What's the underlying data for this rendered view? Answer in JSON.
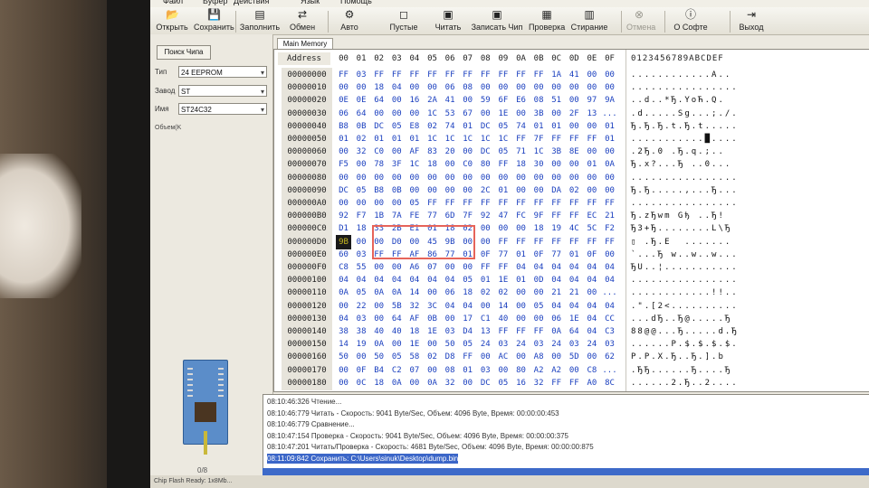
{
  "menu": [
    "Файл",
    "Буфер",
    "Действия",
    "Язык",
    "Помощь"
  ],
  "toolbar": [
    {
      "label": "Открыть",
      "icon": "folder-open-icon",
      "glyph": "📂",
      "enabled": true
    },
    {
      "label": "Сохранить",
      "icon": "floppy-icon",
      "glyph": "💾",
      "enabled": true
    },
    {
      "label": "Заполнить",
      "icon": "fill-icon",
      "glyph": "▤",
      "enabled": true
    },
    {
      "label": "Обмен",
      "icon": "swap-icon",
      "glyph": "⇄",
      "enabled": true
    },
    {
      "label": "Авто",
      "icon": "auto-icon",
      "glyph": "⚙",
      "enabled": true
    },
    {
      "label": "Пустые",
      "icon": "eraser-icon",
      "glyph": "◻",
      "enabled": true
    },
    {
      "label": "Читать",
      "icon": "read-chip-icon",
      "glyph": "▣",
      "enabled": true
    },
    {
      "label": "Записать Чип",
      "icon": "write-chip-icon",
      "glyph": "▣",
      "enabled": true
    },
    {
      "label": "Проверка",
      "icon": "verify-icon",
      "glyph": "▦",
      "enabled": true
    },
    {
      "label": "Стирание",
      "icon": "erase-icon",
      "glyph": "▥",
      "enabled": true
    },
    {
      "label": "Отмена",
      "icon": "cancel-icon",
      "glyph": "⊗",
      "enabled": false
    },
    {
      "label": "О Софте",
      "icon": "info-icon",
      "glyph": "ⓘ",
      "enabled": true
    },
    {
      "label": "Выход",
      "icon": "exit-icon",
      "glyph": "⇥",
      "enabled": true
    }
  ],
  "left": {
    "find_chip": "Поиск Чипа",
    "type_label": "Тип",
    "type_value": "24 EEPROM",
    "vendor_label": "Завод",
    "vendor_value": "ST",
    "name_label": "Имя",
    "name_value": "ST24C32",
    "volume_label": "Объем(K",
    "page": "0/8"
  },
  "memory": {
    "tab": "Main Memory",
    "address_header": "Address",
    "col_headers": [
      "00",
      "01",
      "02",
      "03",
      "04",
      "05",
      "06",
      "07",
      "08",
      "09",
      "0A",
      "0B",
      "0C",
      "0D",
      "0E",
      "0F"
    ],
    "ascii_header": "0123456789ABCDEF",
    "selected_cell": {
      "row": 13,
      "col": 0
    },
    "rows": [
      {
        "addr": "00000000",
        "bytes": [
          "FF",
          "03",
          "FF",
          "FF",
          "FF",
          "FF",
          "FF",
          "FF",
          "FF",
          "FF",
          "FF",
          "FF",
          "1A",
          "41",
          "00",
          "00"
        ],
        "ascii": "............A.."
      },
      {
        "addr": "00000010",
        "bytes": [
          "00",
          "00",
          "18",
          "04",
          "00",
          "00",
          "06",
          "08",
          "00",
          "00",
          "00",
          "00",
          "00",
          "00",
          "00",
          "00"
        ],
        "ascii": "................"
      },
      {
        "addr": "00000020",
        "bytes": [
          "0E",
          "0E",
          "64",
          "00",
          "16",
          "2A",
          "41",
          "00",
          "59",
          "6F",
          "E6",
          "08",
          "51",
          "00",
          "97",
          "9A"
        ],
        "ascii": "..d..*Ђ.YoЋ.Q."
      },
      {
        "addr": "00000030",
        "bytes": [
          "06",
          "64",
          "00",
          "00",
          "00",
          "1C",
          "53",
          "67",
          "00",
          "1E",
          "00",
          "3B",
          "00",
          "2F",
          "13",
          "..."
        ],
        "ascii": ".d.....Sg...;./."
      },
      {
        "addr": "00000040",
        "bytes": [
          "B8",
          "0B",
          "DC",
          "05",
          "E8",
          "02",
          "74",
          "01",
          "DC",
          "05",
          "74",
          "01",
          "01",
          "00",
          "00",
          "01"
        ],
        "ascii": "Ђ.Ђ.Ђ.t.Ђ.t....."
      },
      {
        "addr": "00000050",
        "bytes": [
          "01",
          "02",
          "01",
          "01",
          "01",
          "1C",
          "1C",
          "1C",
          "1C",
          "1C",
          "FF",
          "7F",
          "FF",
          "FF",
          "FF",
          "01"
        ],
        "ascii": "...........█...."
      },
      {
        "addr": "00000060",
        "bytes": [
          "00",
          "32",
          "C0",
          "00",
          "AF",
          "83",
          "20",
          "00",
          "DC",
          "05",
          "71",
          "1C",
          "3B",
          "8E",
          "00",
          "00"
        ],
        "ascii": ".2Ђ.0 .Ђ.q.;.."
      },
      {
        "addr": "00000070",
        "bytes": [
          "F5",
          "00",
          "78",
          "3F",
          "1C",
          "18",
          "00",
          "C0",
          "80",
          "FF",
          "18",
          "30",
          "00",
          "00",
          "01",
          "0A"
        ],
        "ascii": "Ђ.x?...Ђ ..0..."
      },
      {
        "addr": "00000080",
        "bytes": [
          "00",
          "00",
          "00",
          "00",
          "00",
          "00",
          "00",
          "00",
          "00",
          "00",
          "00",
          "00",
          "00",
          "00",
          "00",
          "00"
        ],
        "ascii": "................"
      },
      {
        "addr": "00000090",
        "bytes": [
          "DC",
          "05",
          "B8",
          "0B",
          "00",
          "00",
          "00",
          "00",
          "2C",
          "01",
          "00",
          "00",
          "DA",
          "02",
          "00",
          "00"
        ],
        "ascii": "Ђ.Ђ.....,...Ђ..."
      },
      {
        "addr": "000000A0",
        "bytes": [
          "00",
          "00",
          "00",
          "00",
          "05",
          "FF",
          "FF",
          "FF",
          "FF",
          "FF",
          "FF",
          "FF",
          "FF",
          "FF",
          "FF",
          "FF"
        ],
        "ascii": "................"
      },
      {
        "addr": "000000B0",
        "bytes": [
          "92",
          "F7",
          "1B",
          "7A",
          "FE",
          "77",
          "6D",
          "7F",
          "92",
          "47",
          "FC",
          "9F",
          "FF",
          "FF",
          "EC",
          "21"
        ],
        "ascii": "Ђ.zЂwm Gђ ..Ђ!"
      },
      {
        "addr": "000000C0",
        "bytes": [
          "D1",
          "18",
          "33",
          "2B",
          "E1",
          "01",
          "18",
          "02",
          "00",
          "00",
          "00",
          "18",
          "19",
          "4C",
          "5C",
          "F2"
        ],
        "ascii": "Ђ3+Ђ........L\\Ђ"
      },
      {
        "addr": "000000D0",
        "bytes": [
          "9B",
          "00",
          "00",
          "D0",
          "00",
          "45",
          "9B",
          "00",
          "00",
          "FF",
          "FF",
          "FF",
          "FF",
          "FF",
          "FF",
          "FF"
        ],
        "ascii": "▯ .Ђ.E  ......."
      },
      {
        "addr": "000000E0",
        "bytes": [
          "60",
          "03",
          "FF",
          "FF",
          "AF",
          "86",
          "77",
          "01",
          "0F",
          "77",
          "01",
          "0F",
          "77",
          "01",
          "0F",
          "00"
        ],
        "ascii": "`...Ђ w..w..w..."
      },
      {
        "addr": "000000F0",
        "bytes": [
          "C8",
          "55",
          "00",
          "00",
          "A6",
          "07",
          "00",
          "00",
          "FF",
          "FF",
          "04",
          "04",
          "04",
          "04",
          "04",
          "04"
        ],
        "ascii": "ЂU..¦..........."
      },
      {
        "addr": "00000100",
        "bytes": [
          "04",
          "04",
          "04",
          "04",
          "04",
          "04",
          "04",
          "05",
          "01",
          "1E",
          "01",
          "0D",
          "04",
          "04",
          "04",
          "04"
        ],
        "ascii": "................"
      },
      {
        "addr": "00000110",
        "bytes": [
          "0A",
          "05",
          "0A",
          "0A",
          "14",
          "00",
          "06",
          "18",
          "02",
          "02",
          "00",
          "00",
          "21",
          "21",
          "00",
          "..."
        ],
        "ascii": "............!!.."
      },
      {
        "addr": "00000120",
        "bytes": [
          "00",
          "22",
          "00",
          "5B",
          "32",
          "3C",
          "04",
          "04",
          "00",
          "14",
          "00",
          "05",
          "04",
          "04",
          "04",
          "04"
        ],
        "ascii": ".\".[2<.........."
      },
      {
        "addr": "00000130",
        "bytes": [
          "04",
          "03",
          "00",
          "64",
          "AF",
          "0B",
          "00",
          "17",
          "C1",
          "40",
          "00",
          "00",
          "06",
          "1E",
          "04",
          "CC"
        ],
        "ascii": "...dЂ..Ђ@.....Ђ"
      },
      {
        "addr": "00000140",
        "bytes": [
          "38",
          "38",
          "40",
          "40",
          "18",
          "1E",
          "03",
          "D4",
          "13",
          "FF",
          "FF",
          "FF",
          "0A",
          "64",
          "04",
          "C3"
        ],
        "ascii": "88@@...Ђ.....d.Ђ"
      },
      {
        "addr": "00000150",
        "bytes": [
          "14",
          "19",
          "0A",
          "00",
          "1E",
          "00",
          "50",
          "05",
          "24",
          "03",
          "24",
          "03",
          "24",
          "03",
          "24",
          "03"
        ],
        "ascii": "......P.$.$.$.$."
      },
      {
        "addr": "00000160",
        "bytes": [
          "50",
          "00",
          "50",
          "05",
          "58",
          "02",
          "D8",
          "FF",
          "00",
          "AC",
          "00",
          "A8",
          "00",
          "5D",
          "00",
          "62"
        ],
        "ascii": "P.P.X.Ђ..Ђ.].b"
      },
      {
        "addr": "00000170",
        "bytes": [
          "00",
          "0F",
          "B4",
          "C2",
          "07",
          "00",
          "08",
          "01",
          "03",
          "00",
          "80",
          "A2",
          "A2",
          "00",
          "C8",
          "..."
        ],
        "ascii": ".ЂЂ......Ђ....Ђ"
      },
      {
        "addr": "00000180",
        "bytes": [
          "00",
          "0C",
          "18",
          "0A",
          "00",
          "0A",
          "32",
          "00",
          "DC",
          "05",
          "16",
          "32",
          "FF",
          "FF",
          "A0",
          "8C"
        ],
        "ascii": "......2.Ђ..2...."
      }
    ]
  },
  "log": [
    "08:10:46:326 Чтение...",
    "08:10:46:779 Читать - Скорость: 9041 Byte/Sec, Объем: 4096 Byte, Время: 00:00:00:453",
    "08:10:46:779 Сравнение...",
    "08:10:47:154 Проверка - Скорость: 9041 Byte/Sec, Объем: 4096 Byte, Время: 00:00:00:375",
    "08:10:47:201 Читать/Проверка - Скорость: 4681 Byte/Sec, Объем: 4096 Byte, Время: 00:00:00:875",
    "08:11:09:842 Сохранить: C:\\Users\\sinuk\\Desktop\\dump.bin"
  ],
  "status": "Chip Flash Ready: 1x8Mb..."
}
